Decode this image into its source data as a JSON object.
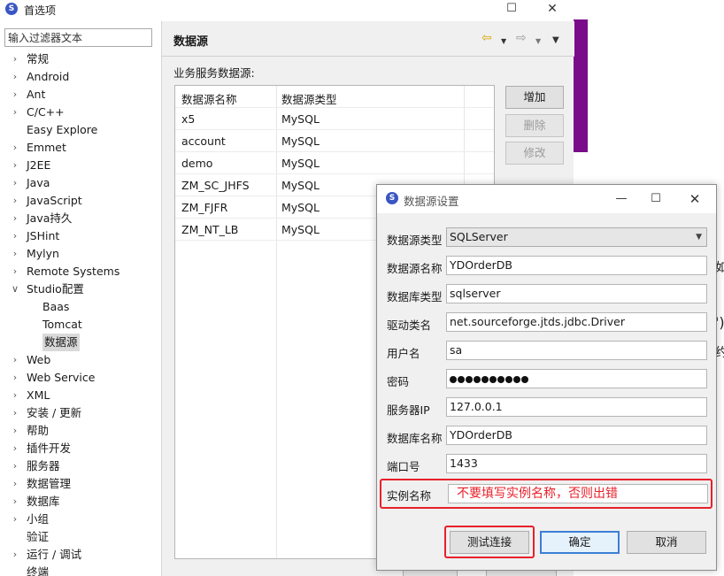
{
  "main_window": {
    "title": "首选项",
    "logo_letter": "S",
    "maximize_glyph": "☐",
    "close_glyph": "✕"
  },
  "filter": {
    "placeholder": "输入过滤器文本"
  },
  "tree": [
    {
      "label": "常规",
      "expandable": true
    },
    {
      "label": "Android",
      "expandable": true
    },
    {
      "label": "Ant",
      "expandable": true
    },
    {
      "label": "C/C++",
      "expandable": true
    },
    {
      "label": "Easy Explore",
      "expandable": false
    },
    {
      "label": "Emmet",
      "expandable": true
    },
    {
      "label": "J2EE",
      "expandable": true
    },
    {
      "label": "Java",
      "expandable": true
    },
    {
      "label": "JavaScript",
      "expandable": true
    },
    {
      "label": "Java持久",
      "expandable": true
    },
    {
      "label": "JSHint",
      "expandable": true
    },
    {
      "label": "Mylyn",
      "expandable": true
    },
    {
      "label": "Remote Systems",
      "expandable": true
    },
    {
      "label": "Studio配置",
      "expandable": true,
      "expanded": true
    },
    {
      "label": "Baas",
      "child": true
    },
    {
      "label": "Tomcat",
      "child": true
    },
    {
      "label": "数据源",
      "child": true,
      "selected": true
    },
    {
      "label": "Web",
      "expandable": true
    },
    {
      "label": "Web Service",
      "expandable": true
    },
    {
      "label": "XML",
      "expandable": true
    },
    {
      "label": "安装 / 更新",
      "expandable": true
    },
    {
      "label": "帮助",
      "expandable": true
    },
    {
      "label": "插件开发",
      "expandable": true
    },
    {
      "label": "服务器",
      "expandable": true
    },
    {
      "label": "数据管理",
      "expandable": true
    },
    {
      "label": "数据库",
      "expandable": true
    },
    {
      "label": "小组",
      "expandable": true
    },
    {
      "label": "验证",
      "expandable": false
    },
    {
      "label": "运行 / 调试",
      "expandable": true
    },
    {
      "label": "终端",
      "expandable": false
    }
  ],
  "page": {
    "title": "数据源",
    "section_label": "业务服务数据源:",
    "table": {
      "columns": [
        "数据源名称",
        "数据源类型"
      ],
      "rows": [
        [
          "x5",
          "MySQL"
        ],
        [
          "account",
          "MySQL"
        ],
        [
          "demo",
          "MySQL"
        ],
        [
          "ZM_SC_JHFS",
          "MySQL"
        ],
        [
          "ZM_FJFR",
          "MySQL"
        ],
        [
          "ZM_NT_LB",
          "MySQL"
        ]
      ]
    },
    "buttons": {
      "add": "增加",
      "delete": "删除",
      "modify": "修改"
    },
    "nav": {
      "back_glyph": "⇦",
      "forward_glyph": "⇨",
      "dropdown_glyph": "▼"
    }
  },
  "background_glyphs": [
    "如",
    "')",
    "约"
  ],
  "dialog": {
    "title": "数据源设置",
    "logo_letter": "S",
    "minimize_glyph": "—",
    "maximize_glyph": "☐",
    "close_glyph": "✕",
    "fields": {
      "ds_type": {
        "label": "数据源类型",
        "value": "SQLServer"
      },
      "ds_name": {
        "label": "数据源名称",
        "value": "YDOrderDB"
      },
      "db_type": {
        "label": "数据库类型",
        "value": "sqlserver"
      },
      "driver": {
        "label": "驱动类名",
        "value": "net.sourceforge.jtds.jdbc.Driver"
      },
      "username": {
        "label": "用户名",
        "value": "sa"
      },
      "password": {
        "label": "密码",
        "masked_length": 10
      },
      "server_ip": {
        "label": "服务器IP",
        "value": "127.0.0.1"
      },
      "db_name": {
        "label": "数据库名称",
        "value": "YDOrderDB"
      },
      "port": {
        "label": "端口号",
        "value": "1433"
      },
      "instance": {
        "label": "实例名称",
        "value": "不要填写实例名称，否则出错"
      }
    },
    "buttons": {
      "test": "测试连接",
      "ok": "确定",
      "cancel": "取消"
    }
  },
  "colors": {
    "highlight_red": "#e8202a",
    "brand_purple": "#7a0c8c",
    "ok_border_blue": "#3c7fd4"
  }
}
